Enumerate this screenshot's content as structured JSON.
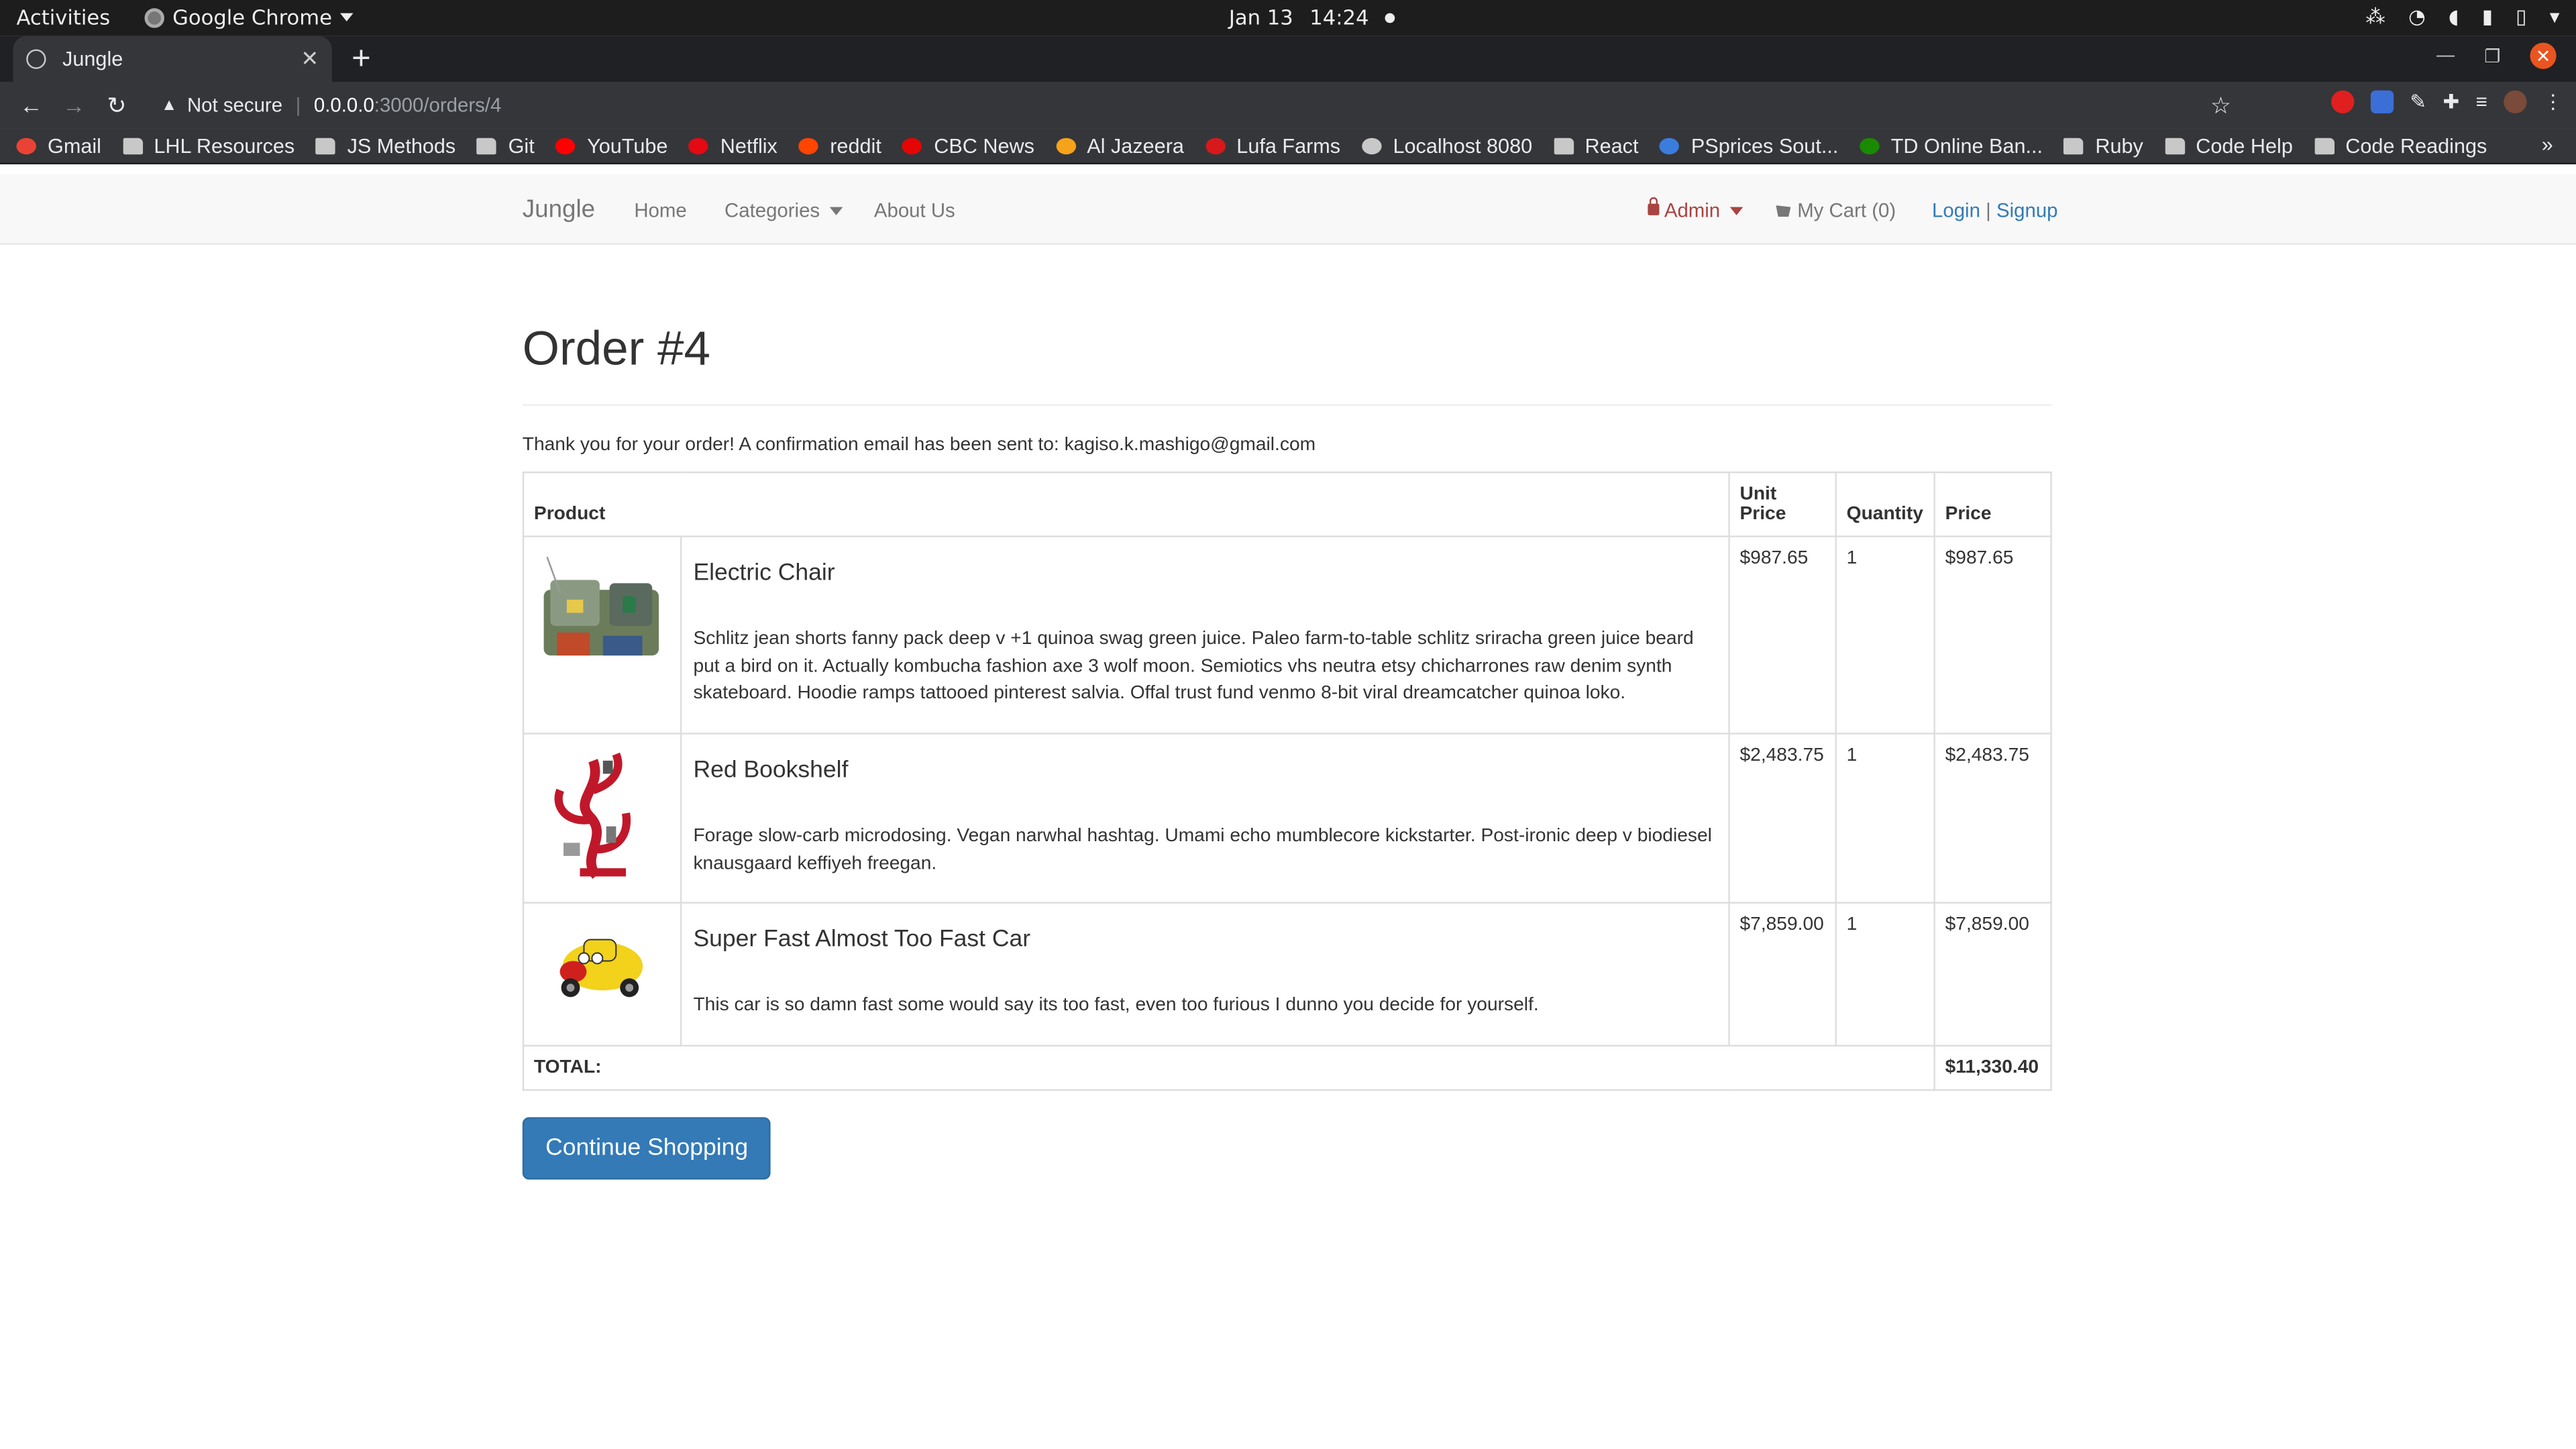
{
  "os": {
    "activities": "Activities",
    "app_name": "Google Chrome",
    "date": "Jan 13",
    "time": "14:24"
  },
  "browser": {
    "tab_title": "Jungle",
    "not_secure": "Not secure",
    "url_host": "0.0.0.0",
    "url_path": ":3000/orders/4",
    "bookmarks": [
      {
        "label": "Gmail",
        "icon": "gmail-icon",
        "color": "#ea4335"
      },
      {
        "label": "LHL Resources",
        "icon": "folder-icon",
        "color": "#c8c8c8"
      },
      {
        "label": "JS Methods",
        "icon": "folder-icon",
        "color": "#c8c8c8"
      },
      {
        "label": "Git",
        "icon": "folder-icon",
        "color": "#c8c8c8"
      },
      {
        "label": "YouTube",
        "icon": "youtube-icon",
        "color": "#ff0000"
      },
      {
        "label": "Netflix",
        "icon": "netflix-icon",
        "color": "#e50914"
      },
      {
        "label": "reddit",
        "icon": "reddit-icon",
        "color": "#ff4500"
      },
      {
        "label": "CBC News",
        "icon": "cbc-icon",
        "color": "#e60505"
      },
      {
        "label": "Al Jazeera",
        "icon": "aljazeera-icon",
        "color": "#f7a21b"
      },
      {
        "label": "Lufa Farms",
        "icon": "lufa-icon",
        "color": "#d7191c"
      },
      {
        "label": "Localhost 8080",
        "icon": "globe-icon",
        "color": "#c8c8c8"
      },
      {
        "label": "React",
        "icon": "folder-icon",
        "color": "#c8c8c8"
      },
      {
        "label": "PSprices Sout...",
        "icon": "psprices-icon",
        "color": "#3b7ddd"
      },
      {
        "label": "TD Online Ban...",
        "icon": "td-icon",
        "color": "#1a8a00"
      },
      {
        "label": "Ruby",
        "icon": "folder-icon",
        "color": "#c8c8c8"
      },
      {
        "label": "Code Help",
        "icon": "folder-icon",
        "color": "#c8c8c8"
      },
      {
        "label": "Code Readings",
        "icon": "folder-icon",
        "color": "#c8c8c8"
      }
    ],
    "more_bookmarks": "»"
  },
  "navbar": {
    "brand": "Jungle",
    "home": "Home",
    "categories": "Categories",
    "about": "About Us",
    "admin": "Admin",
    "cart": "My Cart (0)",
    "login": "Login",
    "separator": "|",
    "signup": "Signup"
  },
  "order": {
    "title": "Order #4",
    "thanks": "Thank you for your order! A confirmation email has been sent to: kagiso.k.mashigo@gmail.com",
    "headers": {
      "product": "Product",
      "unit_price_1": "Unit",
      "unit_price_2": "Price",
      "quantity": "Quantity",
      "price": "Price"
    },
    "items": [
      {
        "name": "Electric Chair",
        "description": "Schlitz jean shorts fanny pack deep v +1 quinoa swag green juice. Paleo farm-to-table schlitz sriracha green juice beard put a bird on it. Actually kombucha fashion axe 3 wolf moon. Semiotics vhs neutra etsy chicharrones raw denim synth skateboard. Hoodie ramps tattooed pinterest salvia. Offal trust fund venmo 8-bit viral dreamcatcher quinoa loko.",
        "unit_price": "$987.65",
        "quantity": "1",
        "price": "$987.65"
      },
      {
        "name": "Red Bookshelf",
        "description": "Forage slow-carb microdosing. Vegan narwhal hashtag. Umami echo mumblecore kickstarter. Post-ironic deep v biodiesel knausgaard keffiyeh freegan.",
        "unit_price": "$2,483.75",
        "quantity": "1",
        "price": "$2,483.75"
      },
      {
        "name": "Super Fast Almost Too Fast Car",
        "description": "This car is so damn fast some would say its too fast, even too furious I dunno you decide for yourself.",
        "unit_price": "$7,859.00",
        "quantity": "1",
        "price": "$7,859.00"
      }
    ],
    "total_label": "TOTAL:",
    "total_value": "$11,330.40",
    "continue_button": "Continue Shopping"
  },
  "colors": {
    "link": "#337ab7",
    "admin": "#a94442",
    "button": "#337ab7"
  }
}
